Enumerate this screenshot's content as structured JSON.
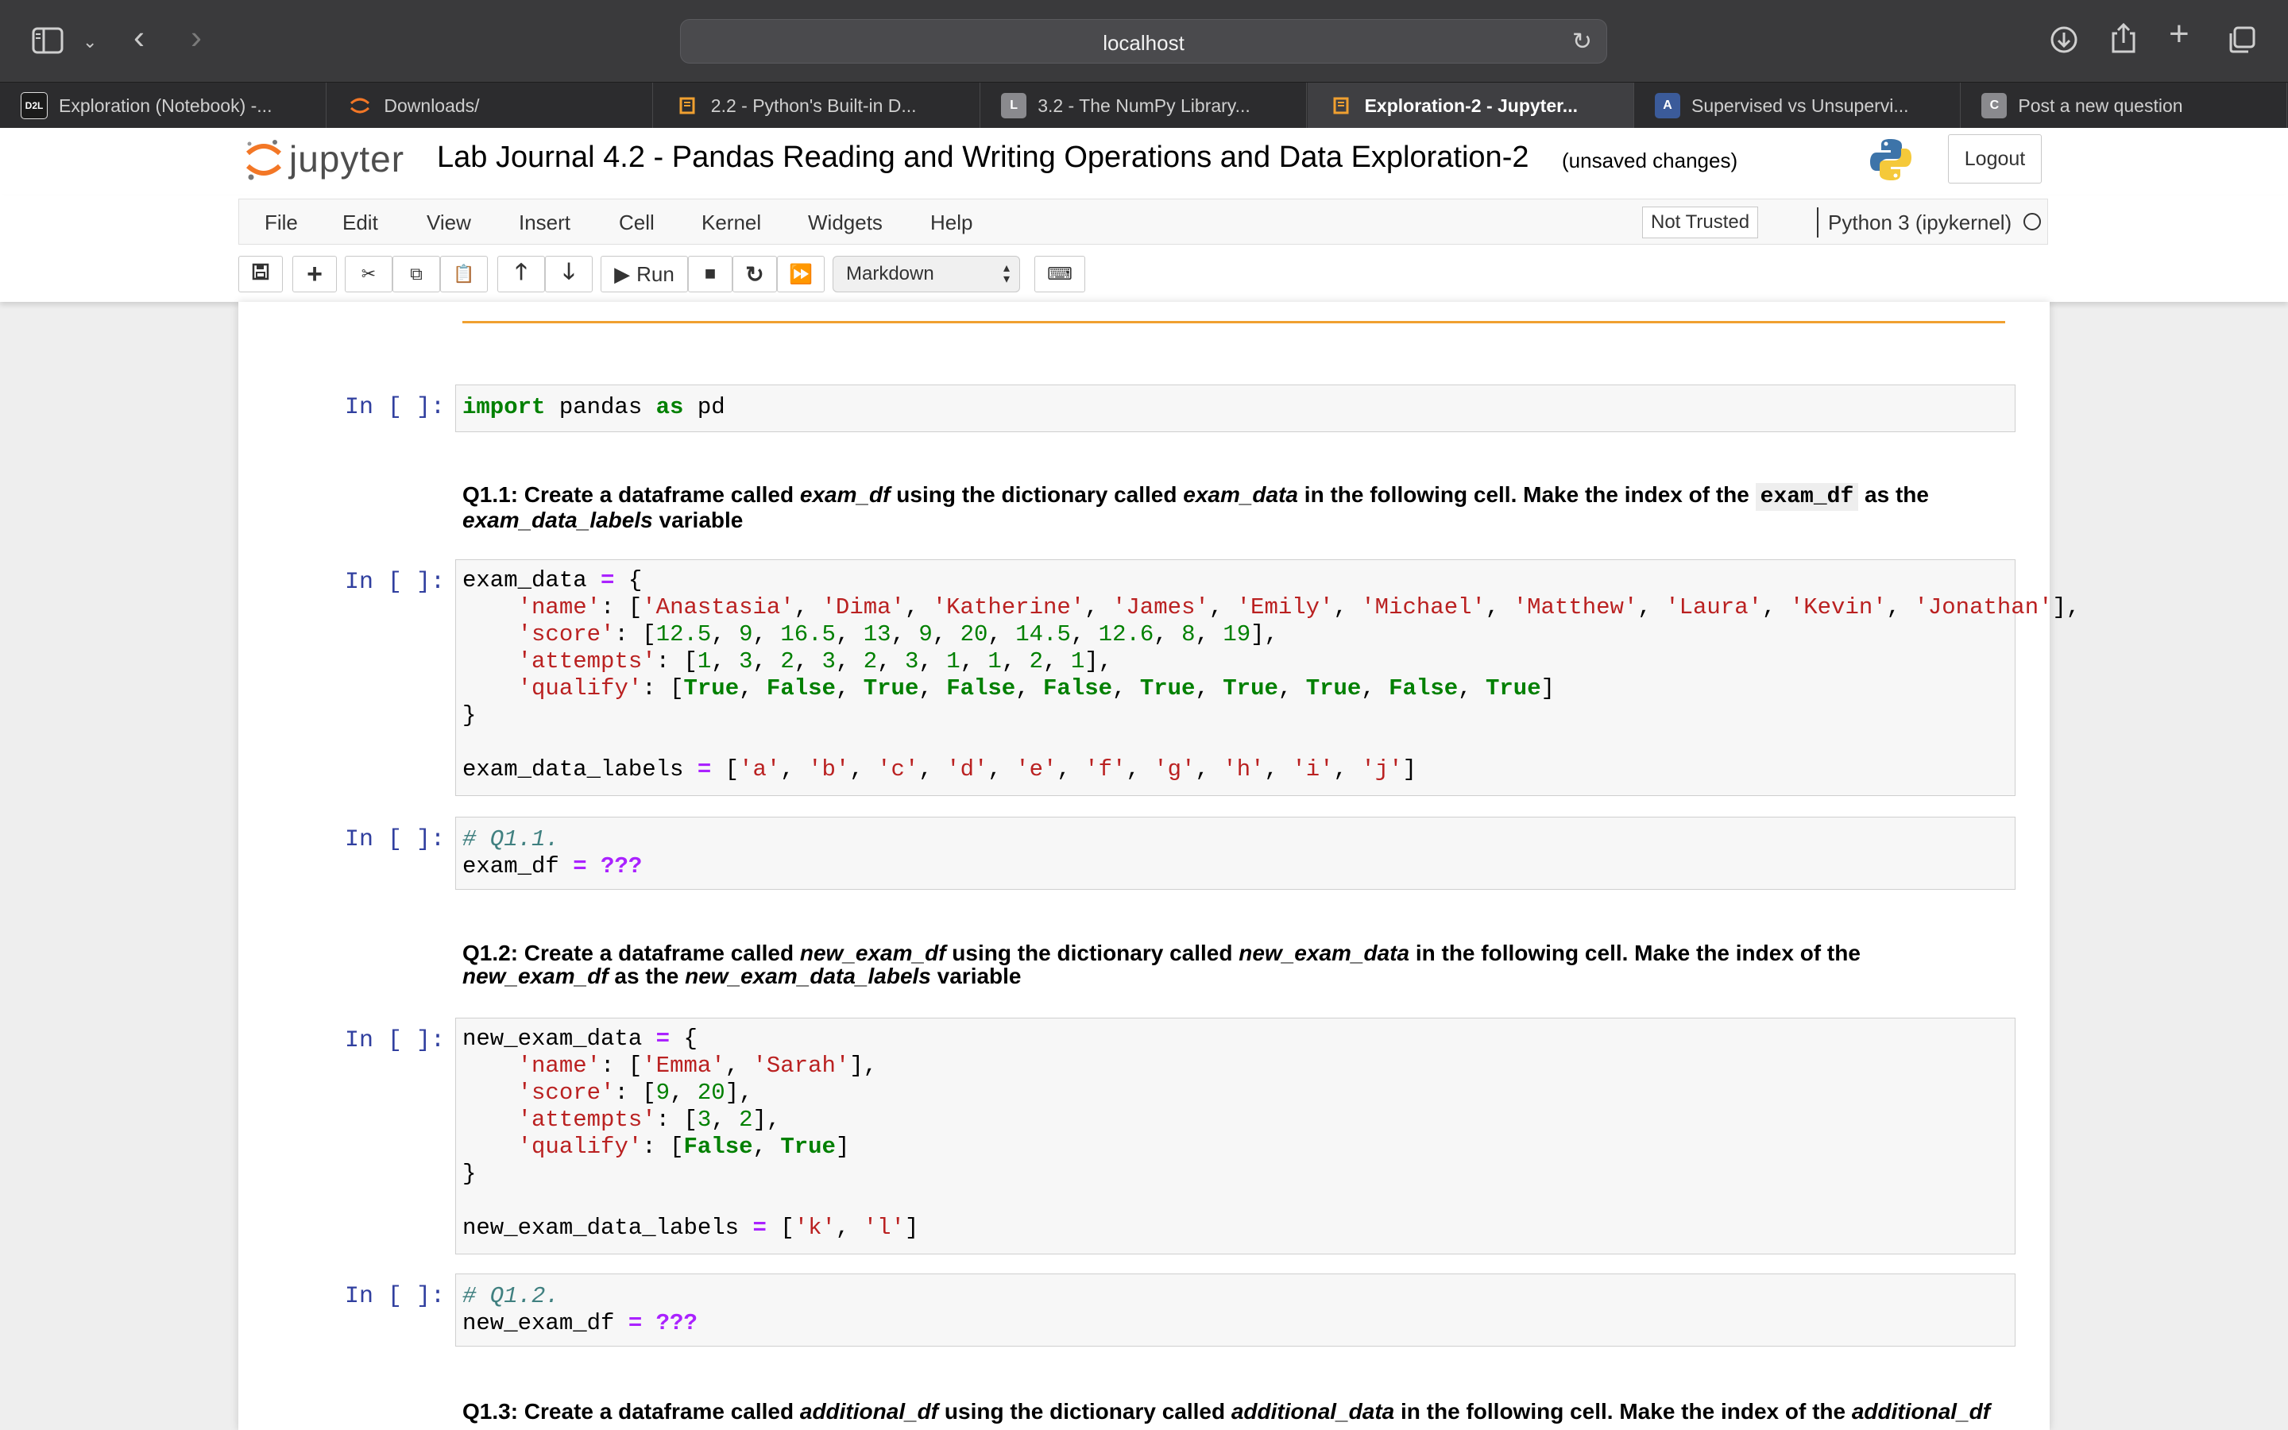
{
  "browser": {
    "url": "localhost",
    "tabs": [
      {
        "label": "Exploration (Notebook) -...",
        "favicon": "D2L",
        "fav_bg": "#1b1b1b",
        "fav_color": "#ffffff"
      },
      {
        "label": "Downloads/",
        "favicon": "jupyter-icon",
        "fav_bg": "transparent",
        "fav_color": "#f37726"
      },
      {
        "label": "2.2 - Python's Built-in D...",
        "favicon": "book-icon",
        "fav_bg": "transparent",
        "fav_color": "#f0a030"
      },
      {
        "label": "3.2 - The NumPy Library...",
        "favicon": "L",
        "fav_bg": "#8a8a8e",
        "fav_color": "#ffffff"
      },
      {
        "label": "Exploration-2 - Jupyter...",
        "favicon": "book-icon",
        "fav_bg": "transparent",
        "fav_color": "#f0a030",
        "active": true
      },
      {
        "label": "Supervised vs Unsupervi...",
        "favicon": "A",
        "fav_bg": "#3b5b9a",
        "fav_color": "#ffffff"
      },
      {
        "label": "Post a new question",
        "favicon": "C",
        "fav_bg": "#8a8a8e",
        "fav_color": "#ffffff"
      }
    ]
  },
  "header": {
    "logo_text": "jupyter",
    "notebook_title": "Lab Journal 4.2 - Pandas Reading and Writing Operations and Data Exploration-2",
    "save_status": "(unsaved changes)",
    "logout_label": "Logout"
  },
  "menu": {
    "items": [
      "File",
      "Edit",
      "View",
      "Insert",
      "Cell",
      "Kernel",
      "Widgets",
      "Help"
    ],
    "trust_label": "Not Trusted",
    "kernel_name": "Python 3 (ipykernel)"
  },
  "toolbar": {
    "run_label": "Run",
    "cell_type": "Markdown"
  },
  "cells": {
    "prompt": "In [ ]:",
    "c1_line1_kw1": "import",
    "c1_line1_mod": " pandas ",
    "c1_line1_kw2": "as",
    "c1_line1_alias": " pd",
    "md1_a": "Q1.1: Create a dataframe called ",
    "md1_b": "exam_df",
    "md1_c": " using the dictionary called ",
    "md1_d": "exam_data",
    "md1_e": " in the following cell. Make the index of the ",
    "md1_f": "exam_df",
    "md1_g": " as the ",
    "md1_h": "exam_data_labels",
    "md1_i": " variable",
    "q11_comment": "# Q1.1.",
    "q11_var": "exam_df ",
    "q11_eq": "=",
    "q11_val": " ???",
    "md2_a": "Q1.2: Create a dataframe called ",
    "md2_b": "new_exam_df",
    "md2_c": " using the dictionary called ",
    "md2_d": "new_exam_data",
    "md2_e": " in the following cell. Make the index of the ",
    "md2_f": "new_exam_df",
    "md2_g": " as the ",
    "md2_h": "new_exam_data_labels",
    "md2_i": " variable",
    "q12_comment": "# Q1.2.",
    "q12_var": "new_exam_df ",
    "q12_eq": "=",
    "q12_val": " ???",
    "md3_a": "Q1.3: Create a dataframe called ",
    "md3_b": "additional_df",
    "md3_c": " using the dictionary called ",
    "md3_d": "additional_data",
    "md3_e": " in the following cell. Make the index of the ",
    "md3_f": "additional_df"
  },
  "exam_code": [
    [
      [
        "",
        "exam_data "
      ],
      [
        "op",
        "="
      ],
      [
        "",
        " {"
      ]
    ],
    [
      [
        "",
        "    "
      ],
      [
        "str",
        "'name'"
      ],
      [
        "",
        ": ["
      ],
      [
        "str",
        "'Anastasia'"
      ],
      [
        "",
        ", "
      ],
      [
        "str",
        "'Dima'"
      ],
      [
        "",
        ", "
      ],
      [
        "str",
        "'Katherine'"
      ],
      [
        "",
        ", "
      ],
      [
        "str",
        "'James'"
      ],
      [
        "",
        ", "
      ],
      [
        "str",
        "'Emily'"
      ],
      [
        "",
        ", "
      ],
      [
        "str",
        "'Michael'"
      ],
      [
        "",
        ", "
      ],
      [
        "str",
        "'Matthew'"
      ],
      [
        "",
        ", "
      ],
      [
        "str",
        "'Laura'"
      ],
      [
        "",
        ", "
      ],
      [
        "str",
        "'Kevin'"
      ],
      [
        "",
        ", "
      ],
      [
        "str",
        "'Jonathan'"
      ],
      [
        "",
        "],"
      ]
    ],
    [
      [
        "",
        "    "
      ],
      [
        "str",
        "'score'"
      ],
      [
        "",
        ": ["
      ],
      [
        "num",
        "12.5"
      ],
      [
        "",
        ", "
      ],
      [
        "num",
        "9"
      ],
      [
        "",
        ", "
      ],
      [
        "num",
        "16.5"
      ],
      [
        "",
        ", "
      ],
      [
        "num",
        "13"
      ],
      [
        "",
        ", "
      ],
      [
        "num",
        "9"
      ],
      [
        "",
        ", "
      ],
      [
        "num",
        "20"
      ],
      [
        "",
        ", "
      ],
      [
        "num",
        "14.5"
      ],
      [
        "",
        ", "
      ],
      [
        "num",
        "12.6"
      ],
      [
        "",
        ", "
      ],
      [
        "num",
        "8"
      ],
      [
        "",
        ", "
      ],
      [
        "num",
        "19"
      ],
      [
        "",
        "],"
      ]
    ],
    [
      [
        "",
        "    "
      ],
      [
        "str",
        "'attempts'"
      ],
      [
        "",
        ": ["
      ],
      [
        "num",
        "1"
      ],
      [
        "",
        ", "
      ],
      [
        "num",
        "3"
      ],
      [
        "",
        ", "
      ],
      [
        "num",
        "2"
      ],
      [
        "",
        ", "
      ],
      [
        "num",
        "3"
      ],
      [
        "",
        ", "
      ],
      [
        "num",
        "2"
      ],
      [
        "",
        ", "
      ],
      [
        "num",
        "3"
      ],
      [
        "",
        ", "
      ],
      [
        "num",
        "1"
      ],
      [
        "",
        ", "
      ],
      [
        "num",
        "1"
      ],
      [
        "",
        ", "
      ],
      [
        "num",
        "2"
      ],
      [
        "",
        ", "
      ],
      [
        "num",
        "1"
      ],
      [
        "",
        "],"
      ]
    ],
    [
      [
        "",
        "    "
      ],
      [
        "str",
        "'qualify'"
      ],
      [
        "",
        ": ["
      ],
      [
        "kw",
        "True"
      ],
      [
        "",
        ", "
      ],
      [
        "kw",
        "False"
      ],
      [
        "",
        ", "
      ],
      [
        "kw",
        "True"
      ],
      [
        "",
        ", "
      ],
      [
        "kw",
        "False"
      ],
      [
        "",
        ", "
      ],
      [
        "kw",
        "False"
      ],
      [
        "",
        ", "
      ],
      [
        "kw",
        "True"
      ],
      [
        "",
        ", "
      ],
      [
        "kw",
        "True"
      ],
      [
        "",
        ", "
      ],
      [
        "kw",
        "True"
      ],
      [
        "",
        ", "
      ],
      [
        "kw",
        "False"
      ],
      [
        "",
        ", "
      ],
      [
        "kw",
        "True"
      ],
      [
        "",
        "]"
      ]
    ],
    [
      [
        "",
        "}"
      ]
    ],
    [
      [
        "",
        ""
      ]
    ],
    [
      [
        "",
        "exam_data_labels "
      ],
      [
        "op",
        "="
      ],
      [
        "",
        " ["
      ],
      [
        "str",
        "'a'"
      ],
      [
        "",
        ", "
      ],
      [
        "str",
        "'b'"
      ],
      [
        "",
        ", "
      ],
      [
        "str",
        "'c'"
      ],
      [
        "",
        ", "
      ],
      [
        "str",
        "'d'"
      ],
      [
        "",
        ", "
      ],
      [
        "str",
        "'e'"
      ],
      [
        "",
        ", "
      ],
      [
        "str",
        "'f'"
      ],
      [
        "",
        ", "
      ],
      [
        "str",
        "'g'"
      ],
      [
        "",
        ", "
      ],
      [
        "str",
        "'h'"
      ],
      [
        "",
        ", "
      ],
      [
        "str",
        "'i'"
      ],
      [
        "",
        ", "
      ],
      [
        "str",
        "'j'"
      ],
      [
        "",
        "]"
      ]
    ]
  ],
  "new_exam_code": [
    [
      [
        "",
        "new_exam_data "
      ],
      [
        "op",
        "="
      ],
      [
        "",
        " {"
      ]
    ],
    [
      [
        "",
        "    "
      ],
      [
        "str",
        "'name'"
      ],
      [
        "",
        ": ["
      ],
      [
        "str",
        "'Emma'"
      ],
      [
        "",
        ", "
      ],
      [
        "str",
        "'Sarah'"
      ],
      [
        "",
        "],"
      ]
    ],
    [
      [
        "",
        "    "
      ],
      [
        "str",
        "'score'"
      ],
      [
        "",
        ": ["
      ],
      [
        "num",
        "9"
      ],
      [
        "",
        ", "
      ],
      [
        "num",
        "20"
      ],
      [
        "",
        "],"
      ]
    ],
    [
      [
        "",
        "    "
      ],
      [
        "str",
        "'attempts'"
      ],
      [
        "",
        ": ["
      ],
      [
        "num",
        "3"
      ],
      [
        "",
        ", "
      ],
      [
        "num",
        "2"
      ],
      [
        "",
        "],"
      ]
    ],
    [
      [
        "",
        "    "
      ],
      [
        "str",
        "'qualify'"
      ],
      [
        "",
        ": ["
      ],
      [
        "kw",
        "False"
      ],
      [
        "",
        ", "
      ],
      [
        "kw",
        "True"
      ],
      [
        "",
        "]"
      ]
    ],
    [
      [
        "",
        "}"
      ]
    ],
    [
      [
        "",
        ""
      ]
    ],
    [
      [
        "",
        "new_exam_data_labels "
      ],
      [
        "op",
        "="
      ],
      [
        "",
        " ["
      ],
      [
        "str",
        "'k'"
      ],
      [
        "",
        ", "
      ],
      [
        "str",
        "'l'"
      ],
      [
        "",
        "]"
      ]
    ]
  ]
}
